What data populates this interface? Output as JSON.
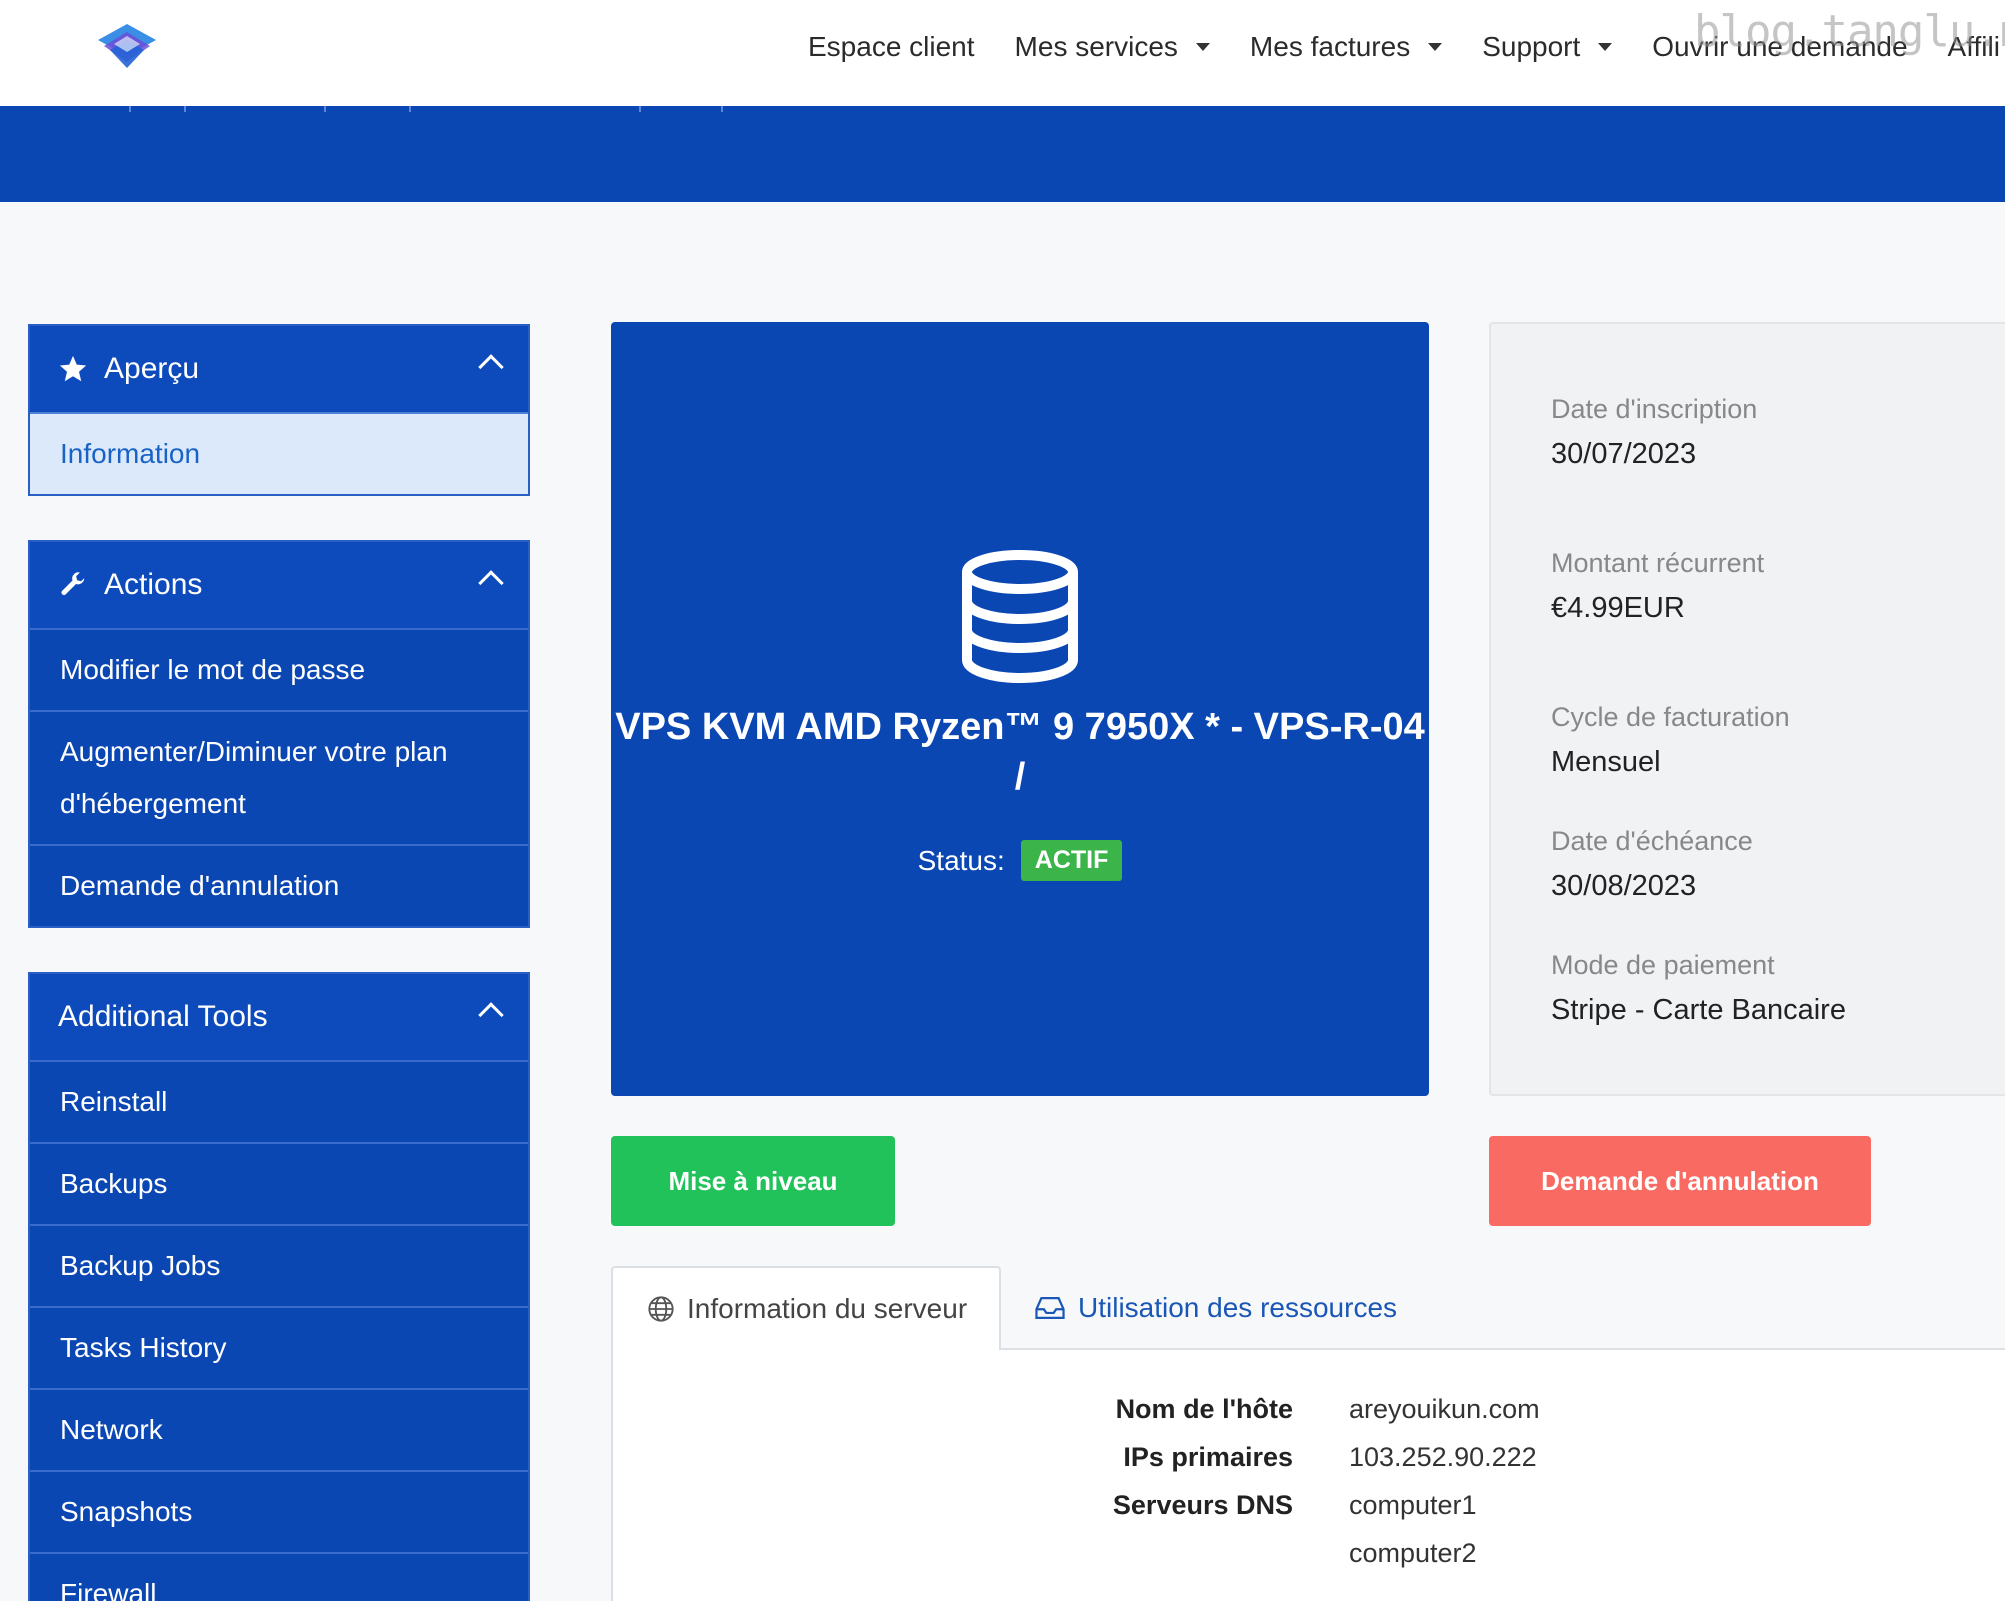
{
  "nav": {
    "items": [
      {
        "label": "Espace client",
        "dropdown": false
      },
      {
        "label": "Mes services",
        "dropdown": true
      },
      {
        "label": "Mes factures",
        "dropdown": true
      },
      {
        "label": "Support",
        "dropdown": true
      },
      {
        "label": "Ouvrir une demande",
        "dropdown": false
      },
      {
        "label": "Affili",
        "dropdown": false
      }
    ],
    "watermark": "blog.tanglu.me"
  },
  "sidebar": {
    "overview": {
      "title": "Aperçu",
      "icon": "star-icon",
      "items": [
        "Information"
      ]
    },
    "actions": {
      "title": "Actions",
      "icon": "wrench-icon",
      "items": [
        "Modifier le mot de passe",
        "Augmenter/Diminuer votre plan d'hébergement",
        "Demande d'annulation"
      ]
    },
    "tools": {
      "title": "Additional Tools",
      "items": [
        "Reinstall",
        "Backups",
        "Backup Jobs",
        "Tasks History",
        "Network",
        "Snapshots",
        "Firewall"
      ]
    }
  },
  "product": {
    "title": "VPS KVM AMD Ryzen™ 9 7950X * - VPS-R-04 /",
    "status_label": "Status:",
    "status_value": "ACTIF",
    "icon": "database-icon"
  },
  "details": {
    "signup_label": "Date d'inscription",
    "signup_value": "30/07/2023",
    "recurring_label": "Montant récurrent",
    "recurring_value": "€4.99EUR",
    "cycle_label": "Cycle de facturation",
    "cycle_value": "Mensuel",
    "due_label": "Date d'échéance",
    "due_value": "30/08/2023",
    "payment_label": "Mode de paiement",
    "payment_value": "Stripe - Carte Bancaire"
  },
  "buttons": {
    "upgrade": "Mise à niveau",
    "cancel": "Demande d'annulation"
  },
  "tabs": {
    "server_info": "Information du serveur",
    "resources": "Utilisation des ressources"
  },
  "server": {
    "hostname_label": "Nom de l'hôte",
    "hostname_value": "areyouikun.com",
    "ip_label": "IPs primaires",
    "ip_value": "103.252.90.222",
    "dns_label": "Serveurs DNS",
    "dns_values": [
      "computer1",
      "computer2"
    ]
  },
  "colors": {
    "primary": "#0b47b3",
    "success": "#22c25a",
    "danger": "#f96b62",
    "badge": "#3bb54a"
  }
}
